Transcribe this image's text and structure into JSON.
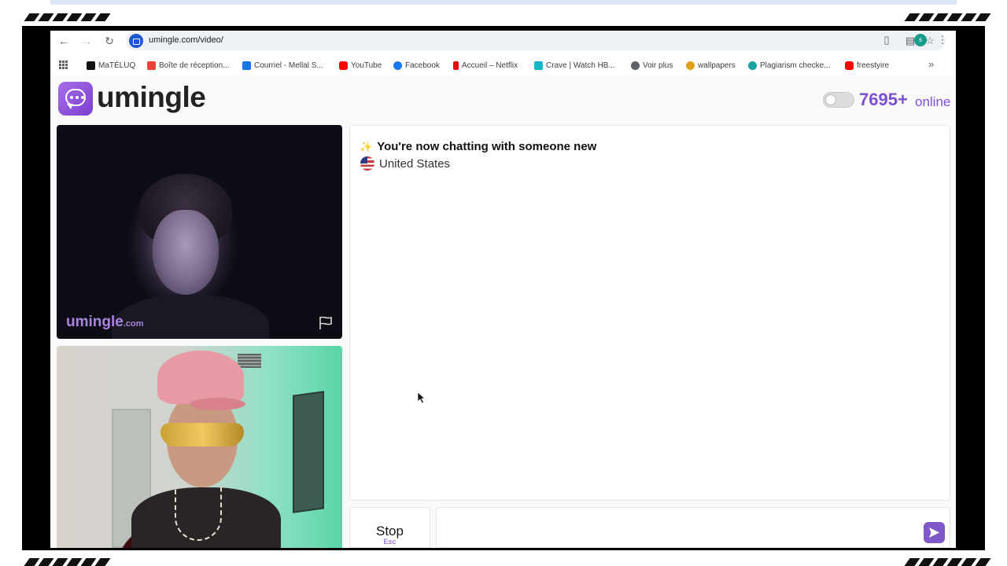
{
  "browser": {
    "url": "umingle.com/video/",
    "profile_initial": "s"
  },
  "bookmarks": [
    {
      "label": "MaTÉLUQ",
      "icon": "teluq-icon",
      "color": "#111111"
    },
    {
      "label": "Boîte de réception...",
      "icon": "gmail-icon",
      "color": "#ea4335"
    },
    {
      "label": "Courriel - Mellal S...",
      "icon": "outlook-icon",
      "color": "#1a73e8"
    },
    {
      "label": "YouTube",
      "icon": "youtube-icon",
      "color": "#ff0000"
    },
    {
      "label": "Facebook",
      "icon": "facebook-icon",
      "color": "#1877f2"
    },
    {
      "label": "Accueil – Netflix",
      "icon": "netflix-icon",
      "color": "#e50914"
    },
    {
      "label": "Crave | Watch HB...",
      "icon": "crave-icon",
      "color": "#19b5c8"
    },
    {
      "label": "Voir plus",
      "icon": "globe-icon",
      "color": "#5f6368"
    },
    {
      "label": "wallpapers",
      "icon": "wallpapers-icon",
      "color": "#e0a020"
    },
    {
      "label": "Plagiarism checke...",
      "icon": "plagiarism-icon",
      "color": "#1aa3a3"
    },
    {
      "label": "freestyire",
      "icon": "youtube-icon",
      "color": "#ff0000"
    }
  ],
  "header": {
    "logo_text": "umingle",
    "online_count": "7695+",
    "online_label": "online",
    "accent_color": "#7c4fcf"
  },
  "remote_video": {
    "watermark": "umingle",
    "watermark_suffix": ".com"
  },
  "chat": {
    "status_icon": "✨",
    "status_text": "You're now chatting with someone new",
    "country": "United States"
  },
  "controls": {
    "stop_label": "Stop",
    "stop_hint": "Esc",
    "message_placeholder": ""
  }
}
